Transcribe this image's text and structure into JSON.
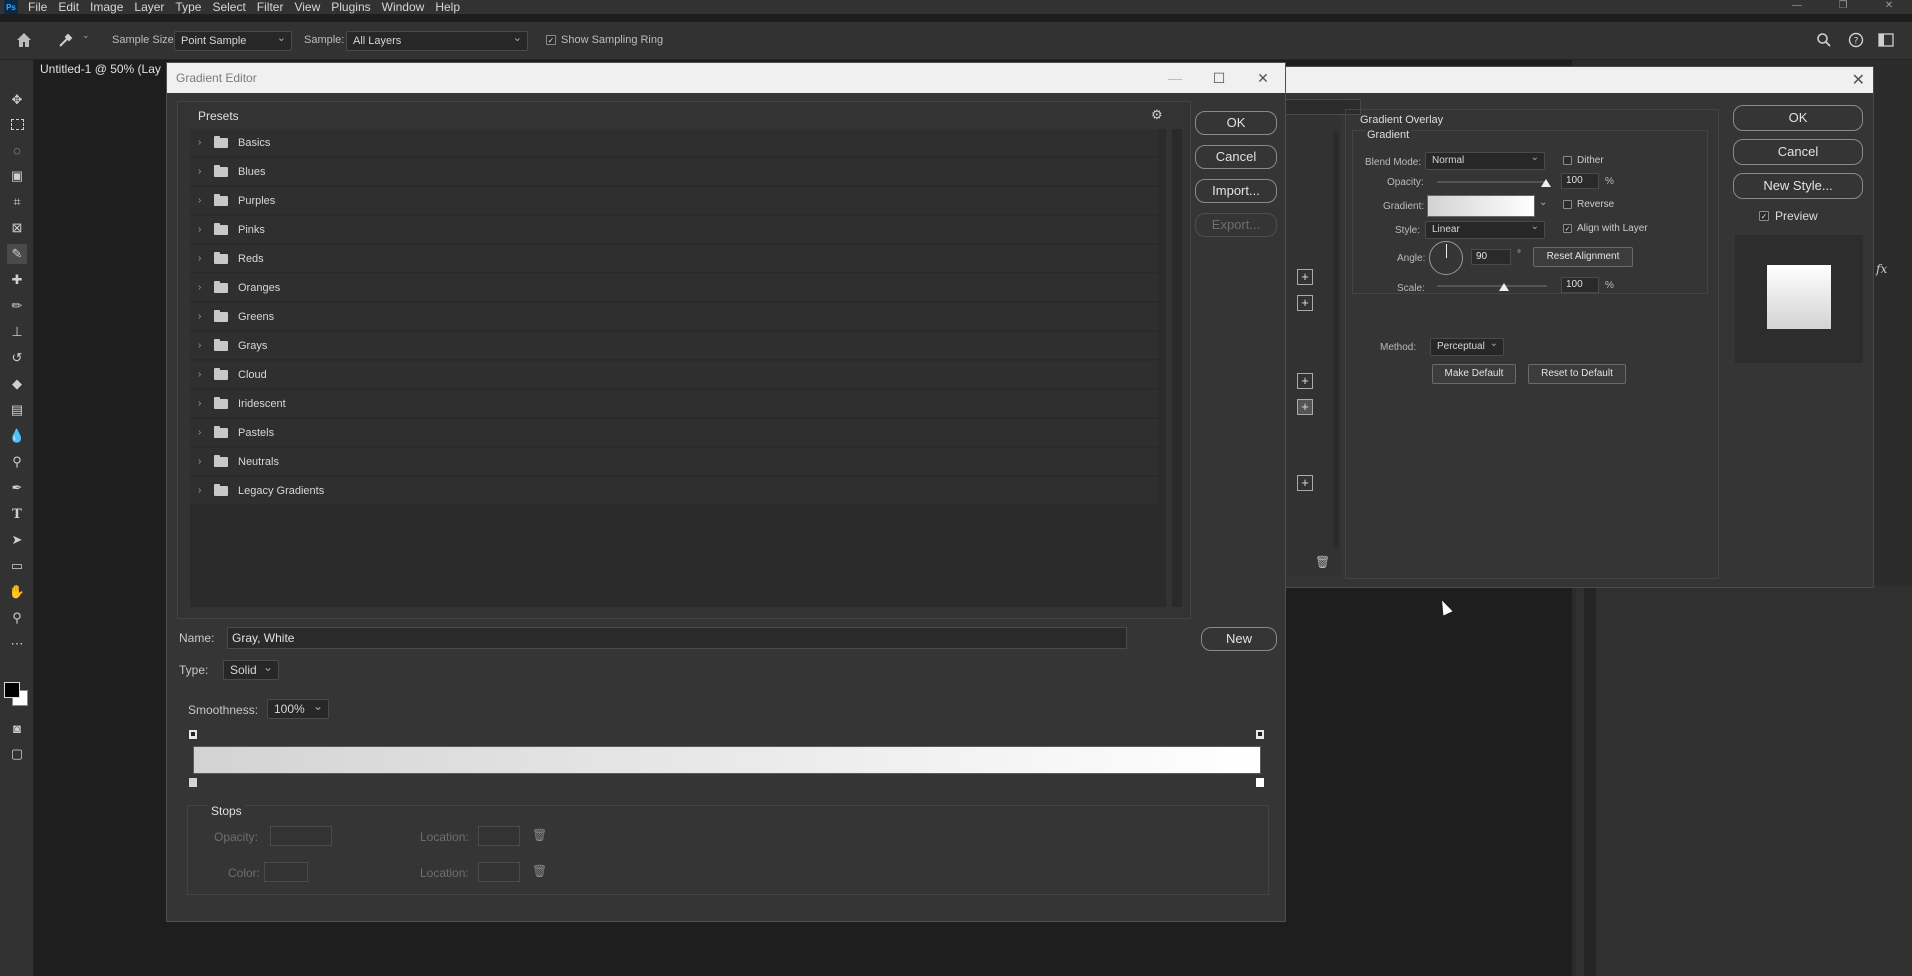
{
  "menubar": {
    "logo": "Ps",
    "items": [
      "File",
      "Edit",
      "Image",
      "Layer",
      "Type",
      "Select",
      "Filter",
      "View",
      "Plugins",
      "Window",
      "Help"
    ],
    "window_controls": [
      "—",
      "❐",
      "✕"
    ]
  },
  "options": {
    "sample_size_label": "Sample Size:",
    "sample_size_value": "Point Sample",
    "sample_label": "Sample:",
    "sample_value": "All Layers",
    "show_ring_label": "Show Sampling Ring",
    "show_ring_checked": true
  },
  "document": {
    "tab_title": "Untitled-1 @ 50% (Lay"
  },
  "layer_style": {
    "section_title": "Gradient Overlay",
    "group_title": "Gradient",
    "blend_mode_label": "Blend Mode:",
    "blend_mode_value": "Normal",
    "dither_label": "Dither",
    "opacity_label": "Opacity:",
    "opacity_value": "100",
    "percent": "%",
    "gradient_label": "Gradient:",
    "reverse_label": "Reverse",
    "style_label": "Style:",
    "style_value": "Linear",
    "align_label": "Align with Layer",
    "angle_label": "Angle:",
    "angle_value": "90",
    "degree": "°",
    "reset_alignment": "Reset Alignment",
    "scale_label": "Scale:",
    "scale_value": "100",
    "method_label": "Method:",
    "method_value": "Perceptual",
    "make_default": "Make Default",
    "reset_default": "Reset to Default",
    "ok": "OK",
    "cancel": "Cancel",
    "new_style": "New Style...",
    "preview_label": "Preview",
    "fx_label": "fx"
  },
  "gradient_editor": {
    "title": "Gradient Editor",
    "presets_label": "Presets",
    "presets": [
      "Basics",
      "Blues",
      "Purples",
      "Pinks",
      "Reds",
      "Oranges",
      "Greens",
      "Grays",
      "Cloud",
      "Iridescent",
      "Pastels",
      "Neutrals",
      "Legacy Gradients"
    ],
    "ok": "OK",
    "cancel": "Cancel",
    "import": "Import...",
    "export": "Export...",
    "name_label": "Name:",
    "name_value": "Gray, White",
    "new": "New",
    "type_label": "Type:",
    "type_value": "Solid",
    "smoothness_label": "Smoothness:",
    "smoothness_value": "100%",
    "gradient_start_color": "#d3d3d3",
    "gradient_end_color": "#ffffff",
    "stops_label": "Stops",
    "stop_opacity_label": "Opacity:",
    "stop_color_label": "Color:",
    "location_label": "Location:"
  }
}
